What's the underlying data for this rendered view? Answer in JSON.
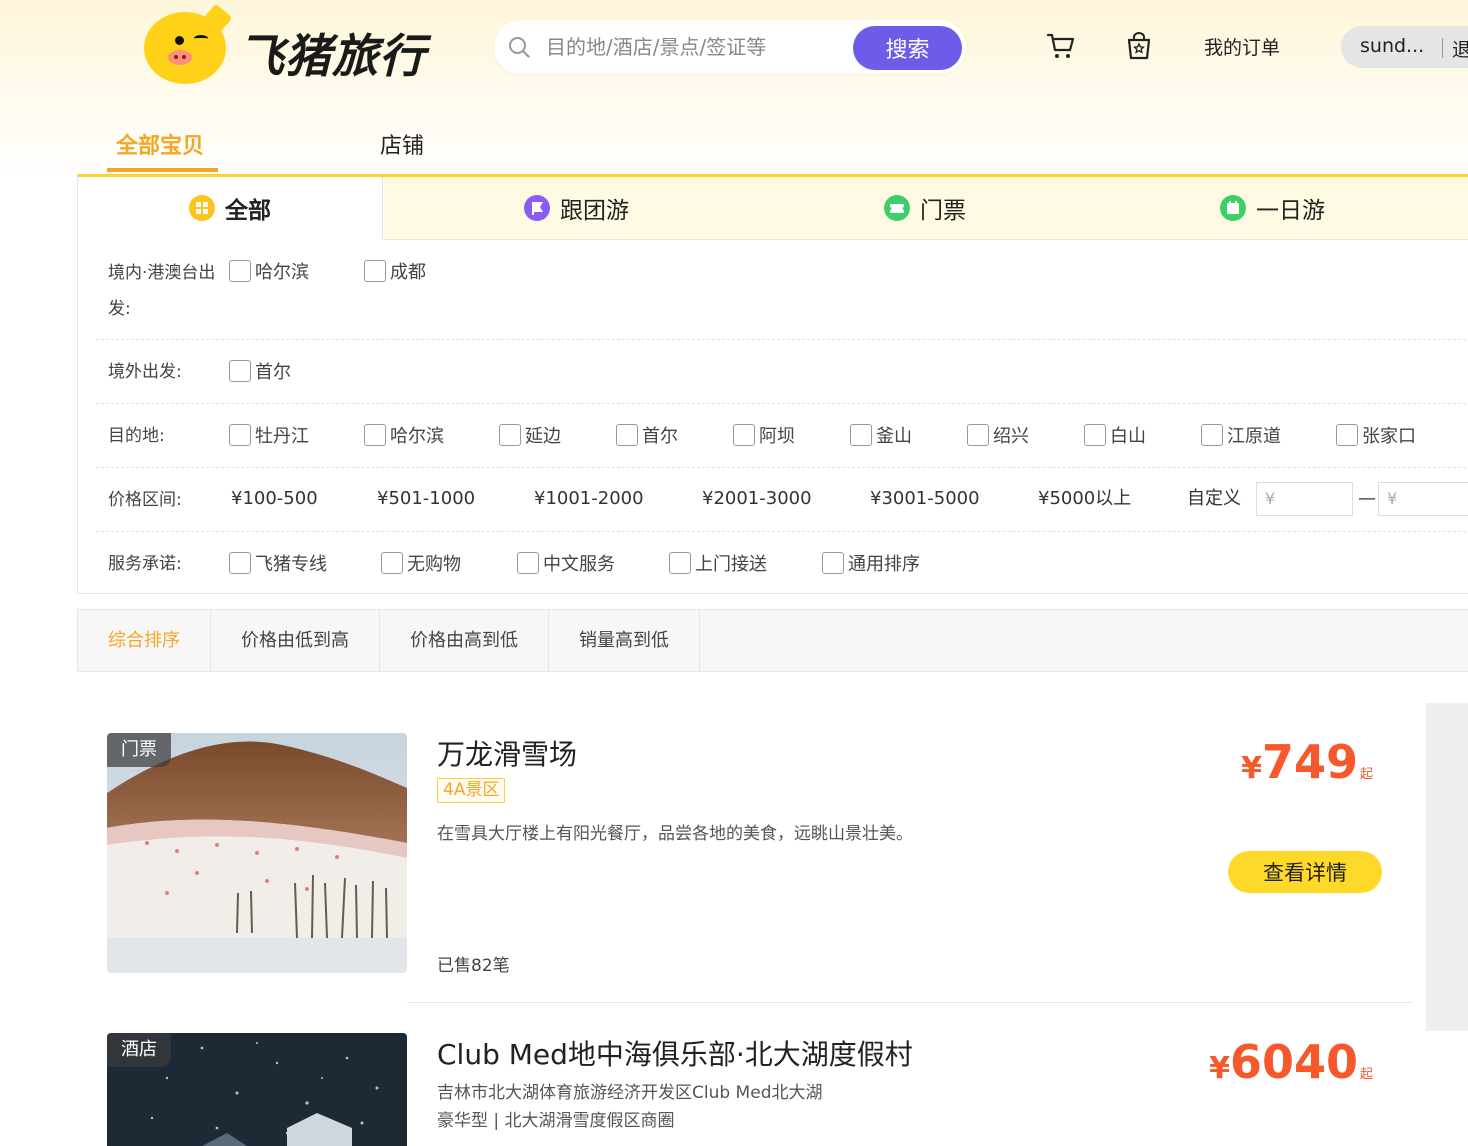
{
  "header": {
    "logo_text": "飞猪旅行",
    "search_placeholder": "目的地/酒店/景点/签证等",
    "search_button": "搜索",
    "my_orders": "我的订单",
    "user_name": "sund...",
    "logout": "退"
  },
  "category_tabs": [
    {
      "label": "全部宝贝",
      "active": true
    },
    {
      "label": "店铺",
      "active": false
    }
  ],
  "type_tabs": [
    {
      "label": "全部",
      "icon": "grid-icon",
      "color": "#ffc21a",
      "active": true
    },
    {
      "label": "跟团游",
      "icon": "flag-icon",
      "color": "#8a5cf6",
      "active": false
    },
    {
      "label": "门票",
      "icon": "ticket-icon",
      "color": "#3ecf6a",
      "active": false
    },
    {
      "label": "一日游",
      "icon": "calendar-icon",
      "color": "#3ecf6a",
      "active": false
    }
  ],
  "filters": {
    "domestic_label_1": "境内·港澳台出",
    "domestic_label_2": "发:",
    "domestic_options": [
      "哈尔滨",
      "成都"
    ],
    "overseas_label": "境外出发:",
    "overseas_options": [
      "首尔"
    ],
    "destination_label": "目的地:",
    "destination_options": [
      "牡丹江",
      "哈尔滨",
      "延边",
      "首尔",
      "阿坝",
      "釜山",
      "绍兴",
      "白山",
      "江原道",
      "张家口"
    ],
    "price_label": "价格区间:",
    "price_options": [
      "¥100-500",
      "¥501-1000",
      "¥1001-2000",
      "¥2001-3000",
      "¥3001-5000",
      "¥5000以上"
    ],
    "custom_label": "自定义",
    "custom_placeholder": "¥",
    "custom_sep": "—",
    "service_label": "服务承诺:",
    "service_options": [
      "飞猪专线",
      "无购物",
      "中文服务",
      "上门接送",
      "通用排序"
    ]
  },
  "sort": [
    {
      "label": "综合排序",
      "active": true
    },
    {
      "label": "价格由低到高",
      "active": false
    },
    {
      "label": "价格由高到低",
      "active": false
    },
    {
      "label": "销量高到低",
      "active": false
    }
  ],
  "products": [
    {
      "badge": "门票",
      "title": "万龙滑雪场",
      "tag": "4A景区",
      "desc": "在雪具大厅楼上有阳光餐厅，品尝各地的美食，远眺山景壮美。",
      "sold": "已售82笔",
      "price_symbol": "¥",
      "price": "749",
      "price_suffix": "起",
      "button": "查看详情"
    },
    {
      "badge": "酒店",
      "title": "Club Med地中海俱乐部·北大湖度假村",
      "addr_line1": "吉林市北大湖体育旅游经济开发区Club Med北大湖",
      "addr_line2": "豪华型 | 北大湖滑雪度假区商圈",
      "price_symbol": "¥",
      "price": "6040",
      "price_suffix": "起"
    }
  ],
  "colors": {
    "accent": "#f5a623",
    "search_button": "#6c5ce7",
    "price": "#f5582b",
    "detail_button": "#ffd92a"
  }
}
